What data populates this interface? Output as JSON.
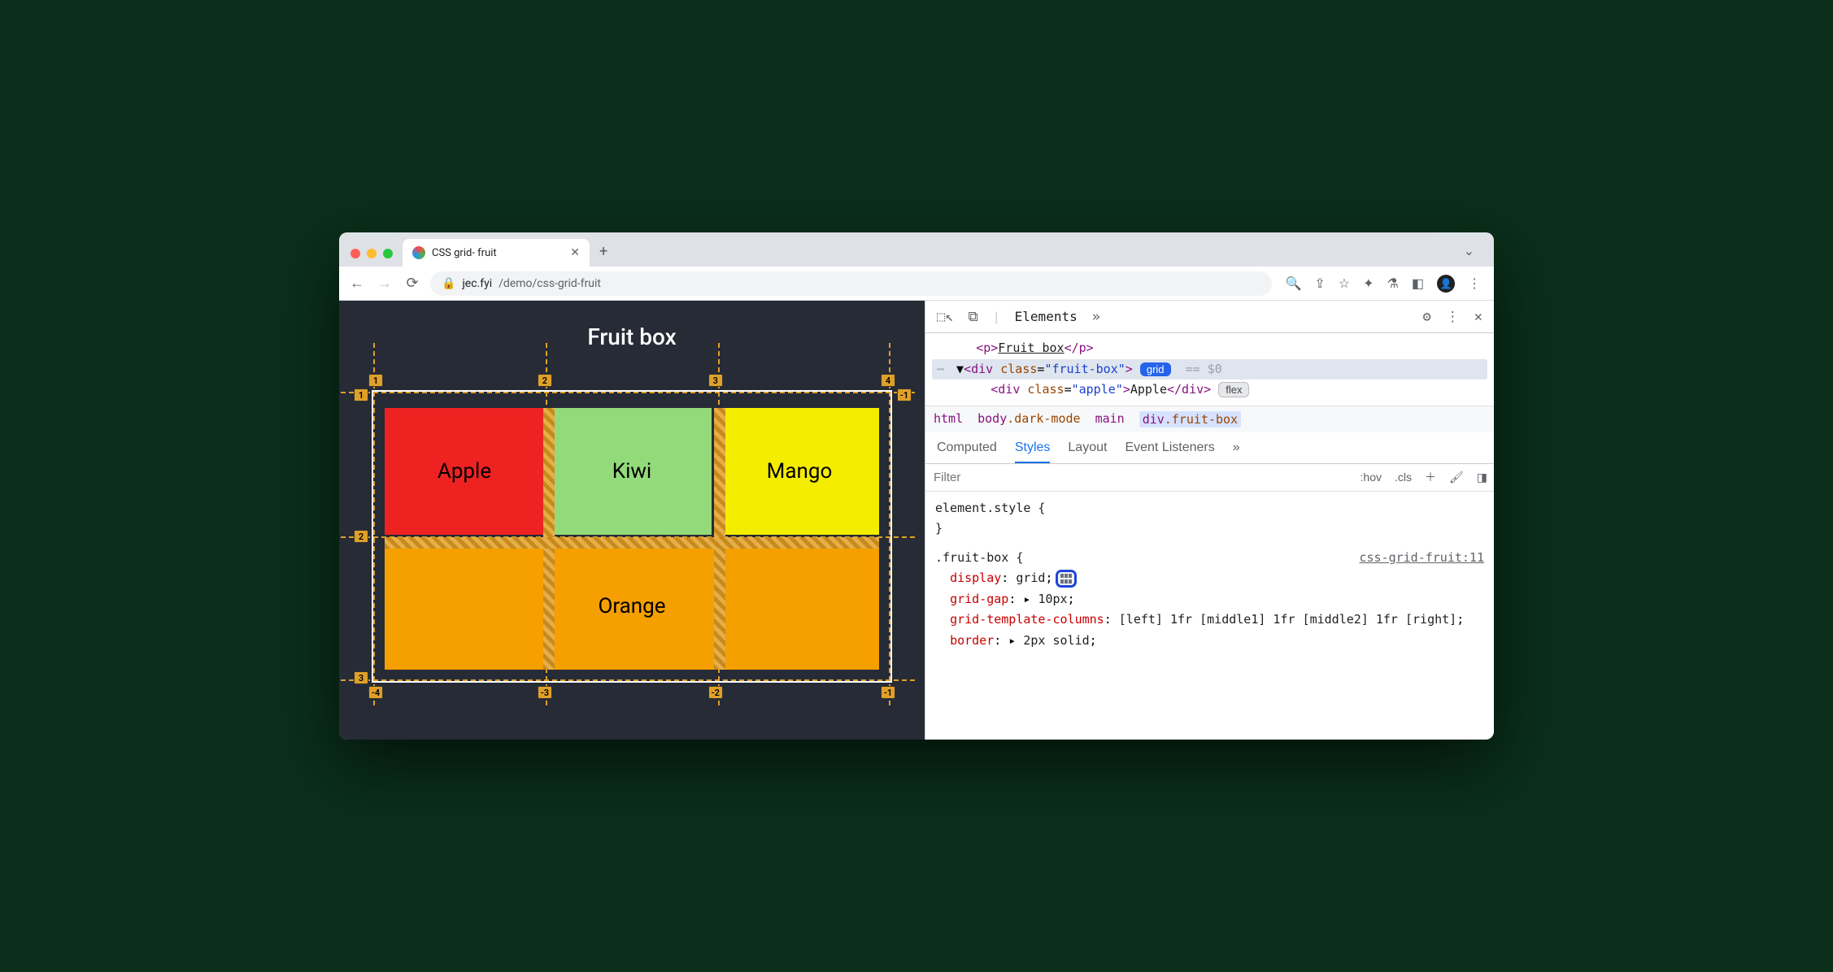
{
  "browser": {
    "tab_title": "CSS grid- fruit",
    "url_host": "jec.fyi",
    "url_path": "/demo/css-grid-fruit"
  },
  "page": {
    "heading": "Fruit box",
    "cells": {
      "apple": "Apple",
      "kiwi": "Kiwi",
      "mango": "Mango",
      "orange": "Orange"
    },
    "grid_lines": {
      "cols_pos": [
        "1",
        "2",
        "3",
        "4"
      ],
      "cols_neg": [
        "-4",
        "-3",
        "-2",
        "-1"
      ],
      "rows_pos": [
        "1",
        "2",
        "3"
      ],
      "rows_neg": [
        "-1"
      ]
    }
  },
  "devtools": {
    "main_tabs": {
      "elements": "Elements"
    },
    "dom": {
      "line1_text": "Fruit box",
      "line2_class": "fruit-box",
      "line2_badge": "grid",
      "line2_suffix": "== $0",
      "line3_class": "apple",
      "line3_text": "Apple",
      "line3_badge": "flex"
    },
    "breadcrumbs": {
      "i0": "html",
      "i1a": "body",
      "i1b": ".dark-mode",
      "i2": "main",
      "i3a": "div",
      "i3b": ".fruit-box"
    },
    "style_tabs": {
      "computed": "Computed",
      "styles": "Styles",
      "layout": "Layout",
      "event": "Event Listeners"
    },
    "filter": {
      "placeholder": "Filter",
      "hov": ":hov",
      "cls": ".cls"
    },
    "styles": {
      "element_style_open": "element.style {",
      "element_style_close": "}",
      "rule_selector": ".fruit-box {",
      "rule_source": "css-grid-fruit:11",
      "p1_name": "display",
      "p1_val": "grid",
      "p2_name": "grid-gap",
      "p2_val": "10px",
      "p3_name": "grid-template-columns",
      "p3_val": "[left] 1fr [middle1] 1fr [middle2] 1fr [right]",
      "p4_name": "border",
      "p4_val": "2px solid"
    }
  }
}
